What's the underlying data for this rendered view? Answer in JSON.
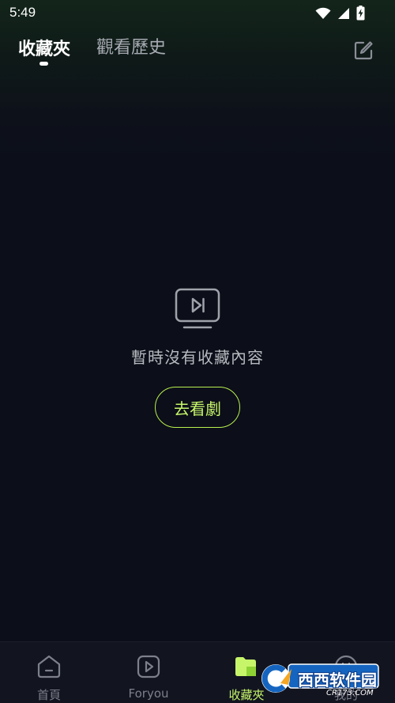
{
  "status_bar": {
    "time": "5:49",
    "icons": [
      "wifi-icon",
      "cellular-signal-icon",
      "battery-charging-icon"
    ]
  },
  "header": {
    "tabs": [
      {
        "label": "收藏夾",
        "active": true
      },
      {
        "label": "觀看歷史",
        "active": false
      }
    ],
    "edit_icon": "edit-icon"
  },
  "empty_state": {
    "icon": "tv-play-icon",
    "message": "暫時沒有收藏內容",
    "button_label": "去看劇"
  },
  "bottom_nav": {
    "items": [
      {
        "label": "首頁",
        "icon": "home-icon",
        "active": false
      },
      {
        "label": "Foryou",
        "icon": "play-square-icon",
        "active": false
      },
      {
        "label": "收藏夾",
        "icon": "favorites-folder-icon",
        "active": true
      },
      {
        "label": "我的",
        "icon": "profile-icon",
        "active": false
      }
    ]
  },
  "watermark": {
    "text": "西西软件园",
    "sub": "CR173.COM"
  },
  "colors": {
    "background": "#0c0e19",
    "accent": "#c6f56a",
    "accent_border": "#b9f04f",
    "muted_text": "#7d808a"
  }
}
